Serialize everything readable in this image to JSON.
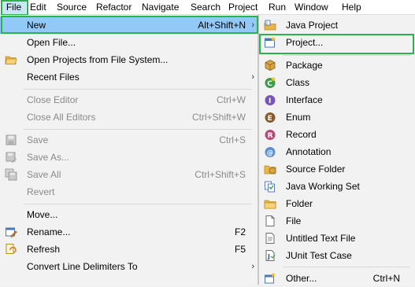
{
  "menubar": {
    "items": [
      "File",
      "Edit",
      "Source",
      "Refactor",
      "Navigate",
      "Search",
      "Project",
      "Run",
      "Window",
      "Help"
    ]
  },
  "file_menu": {
    "new": {
      "label": "New",
      "shortcut": "Alt+Shift+N",
      "arrow": "›"
    },
    "open_file": {
      "label": "Open File..."
    },
    "open_projects": {
      "label": "Open Projects from File System..."
    },
    "recent_files": {
      "label": "Recent Files",
      "arrow": "›"
    },
    "close_editor": {
      "label": "Close Editor",
      "shortcut": "Ctrl+W"
    },
    "close_all_editors": {
      "label": "Close All Editors",
      "shortcut": "Ctrl+Shift+W"
    },
    "save": {
      "label": "Save",
      "shortcut": "Ctrl+S"
    },
    "save_as": {
      "label": "Save As..."
    },
    "save_all": {
      "label": "Save All",
      "shortcut": "Ctrl+Shift+S"
    },
    "revert": {
      "label": "Revert"
    },
    "move": {
      "label": "Move..."
    },
    "rename": {
      "label": "Rename...",
      "shortcut": "F2"
    },
    "refresh": {
      "label": "Refresh",
      "shortcut": "F5"
    },
    "convert_line_delimiters": {
      "label": "Convert Line Delimiters To",
      "arrow": "›"
    }
  },
  "new_submenu": {
    "items": [
      {
        "label": "Java Project",
        "icon": "java-project-icon"
      },
      {
        "label": "Project...",
        "icon": "project-icon"
      },
      {
        "label": "Package",
        "icon": "package-icon"
      },
      {
        "label": "Class",
        "icon": "class-icon"
      },
      {
        "label": "Interface",
        "icon": "interface-icon"
      },
      {
        "label": "Enum",
        "icon": "enum-icon"
      },
      {
        "label": "Record",
        "icon": "record-icon"
      },
      {
        "label": "Annotation",
        "icon": "annotation-icon"
      },
      {
        "label": "Source Folder",
        "icon": "source-folder-icon"
      },
      {
        "label": "Java Working Set",
        "icon": "working-set-icon"
      },
      {
        "label": "Folder",
        "icon": "folder-icon"
      },
      {
        "label": "File",
        "icon": "file-icon"
      },
      {
        "label": "Untitled Text File",
        "icon": "text-file-icon"
      },
      {
        "label": "JUnit Test Case",
        "icon": "junit-icon"
      }
    ],
    "other": {
      "label": "Other...",
      "shortcut": "Ctrl+N",
      "icon": "other-wizard-icon"
    }
  },
  "colors": {
    "highlight": "#91c9f7",
    "outline": "#2bb24c",
    "menu_bg": "#f2f2f2",
    "disabled_text": "#8a8a8a"
  }
}
